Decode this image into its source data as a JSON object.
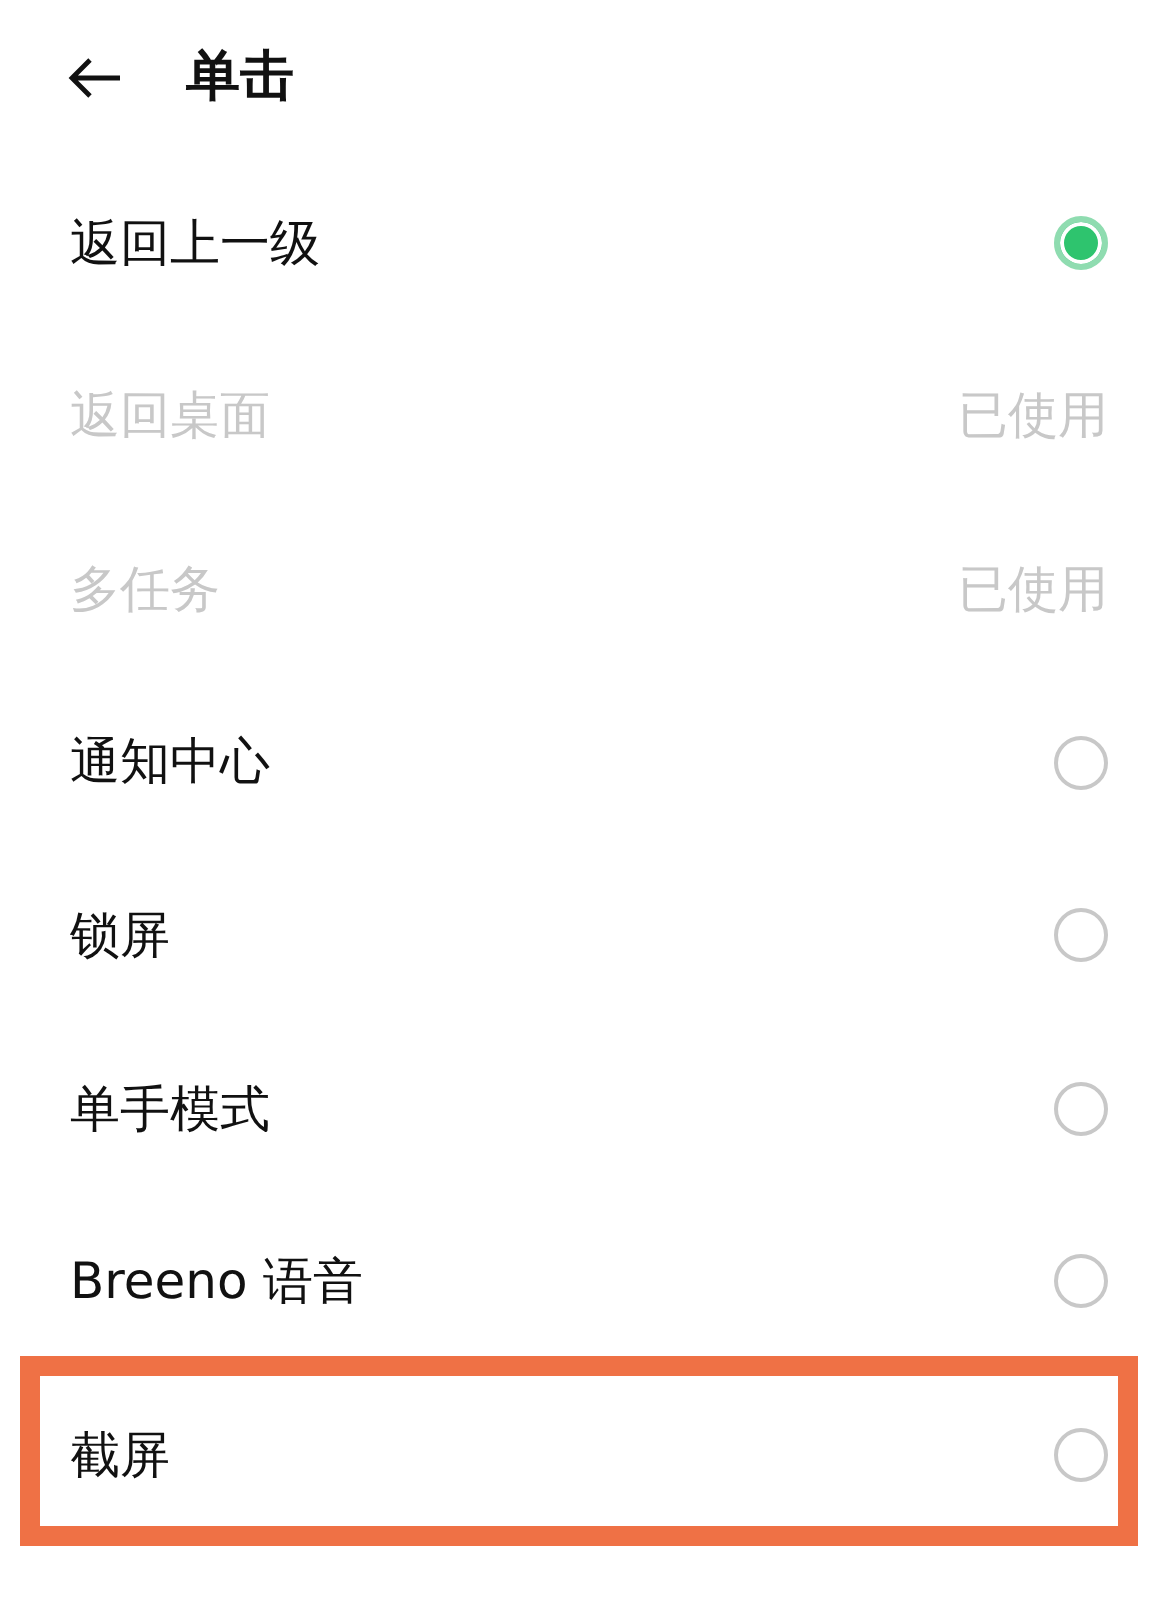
{
  "header": {
    "title": "单击"
  },
  "options": [
    {
      "kind": "radio",
      "label": "返回上一级",
      "selected": true,
      "highlighted": false
    },
    {
      "kind": "used",
      "label": "返回桌面",
      "status": "已使用",
      "highlighted": false
    },
    {
      "kind": "used",
      "label": "多任务",
      "status": "已使用",
      "highlighted": false
    },
    {
      "kind": "radio",
      "label": "通知中心",
      "selected": false,
      "highlighted": false
    },
    {
      "kind": "radio",
      "label": "锁屏",
      "selected": false,
      "highlighted": false
    },
    {
      "kind": "radio",
      "label": "单手模式",
      "selected": false,
      "highlighted": false
    },
    {
      "kind": "radio",
      "label": "Breeno 语音",
      "selected": false,
      "highlighted": false
    },
    {
      "kind": "radio",
      "label": "截屏",
      "selected": false,
      "highlighted": true
    }
  ]
}
